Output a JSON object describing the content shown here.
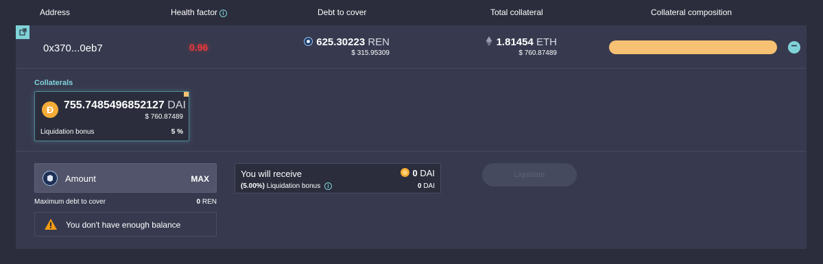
{
  "header": {
    "address": "Address",
    "health_factor": "Health factor",
    "debt_to_cover": "Debt to cover",
    "total_collateral": "Total collateral",
    "collateral_composition": "Collateral composition"
  },
  "row": {
    "address": "0x370...0eb7",
    "health_factor": "0.96",
    "debt": {
      "amount": "625.30223",
      "unit": "REN",
      "usd": "$ 315.95309"
    },
    "collateral": {
      "amount": "1.81454",
      "unit": "ETH",
      "usd": "$ 760.87489"
    },
    "composition": [
      {
        "asset": "DAI",
        "fraction": 1.0,
        "color": "#f6c173"
      }
    ]
  },
  "collaterals": {
    "title": "Collaterals",
    "items": [
      {
        "amount": "755.7485496852127",
        "unit": "DAI",
        "usd": "$ 760.87489",
        "bonus_label": "Liquidation bonus",
        "bonus_value": "5 %"
      }
    ]
  },
  "liquidation": {
    "amount_label": "Amount",
    "max_label": "MAX",
    "max_debt_label": "Maximum debt to cover",
    "max_debt_value": "0",
    "max_debt_unit": "REN",
    "warning": "You don't have enough balance",
    "receive_label": "You will receive",
    "receive_value": "0",
    "receive_unit": "DAI",
    "bonus_percent": "(5.00%)",
    "bonus_label": "Liquidation bonus",
    "bonus_value": "0",
    "bonus_unit": "DAI",
    "button": "Liquidate"
  },
  "colors": {
    "accent": "#7fd3d8",
    "danger": "#e23a3a",
    "dai": "#f5ac37",
    "bar": "#f6c173",
    "background": "#2b2d3c",
    "card": "#373a4f"
  },
  "icons": [
    "external-link-icon",
    "info-icon",
    "ren-coin-icon",
    "eth-icon",
    "minus-icon",
    "dai-coin-icon",
    "warning-icon"
  ]
}
